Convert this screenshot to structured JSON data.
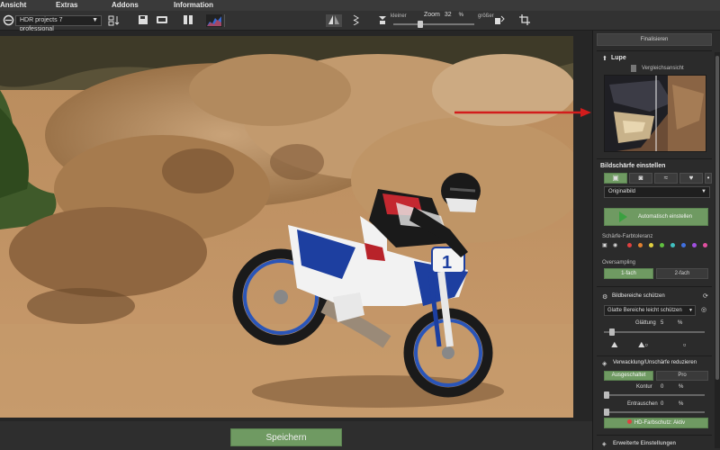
{
  "menu": {
    "items": [
      "Ansicht",
      "Extras",
      "Addons",
      "Information"
    ]
  },
  "toolbar": {
    "project_select": "HDR projects 7 professional",
    "zoom_smaller_label": "kleiner",
    "zoom_label": "Zoom",
    "zoom_value": "32",
    "zoom_unit": "%",
    "zoom_larger_label": "größer",
    "zoom_percent": 32
  },
  "icons": {
    "app": "app-logo-icon",
    "split": "split-view-icon",
    "compare": "compare-icon",
    "crop": "crop-icon",
    "histogram": "histogram-icon"
  },
  "bottom": {
    "save_label": "Speichern"
  },
  "panel": {
    "header_button": "Finalisieren",
    "lupe": {
      "title": "Lupe",
      "compare_label": "Vergleichsansicht"
    },
    "sharpness": {
      "title": "Bildschärfe einstellen",
      "preset_select": "Originalbild",
      "auto_button": "Automatisch einstellen",
      "tolerance_label": "Schärfe-Farbtoleranz",
      "oversampling_label": "Oversampling",
      "oversampling_options": [
        "1-fach",
        "2-fach"
      ],
      "dot_colors": [
        "#e04040",
        "#e08030",
        "#e0d040",
        "#60c040",
        "#40c0c0",
        "#4070e0",
        "#a050e0",
        "#e050a0"
      ]
    },
    "protect": {
      "title": "Bildbereiche schützen",
      "select": "Glatte Bereiche leicht schützen",
      "smoothing_label": "Glättung",
      "smoothing_value": "5",
      "smoothing_unit": "%"
    },
    "blur": {
      "title": "Verwacklung/Unschärfe reduzieren",
      "options": [
        "Ausgeschaltet",
        "Pro"
      ],
      "contour_label": "Kontur",
      "contour_value": "0",
      "contour_unit": "%",
      "denoise_label": "Entrauschen",
      "denoise_value": "0",
      "denoise_unit": "%",
      "hd_button": "HD-Farbschutz: Aktiv"
    },
    "footer_title": "Erweiterte Einstellungen"
  }
}
